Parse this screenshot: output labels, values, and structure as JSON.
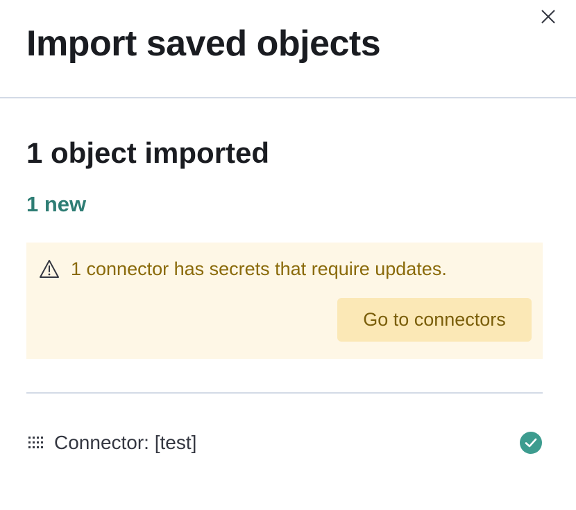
{
  "flyout": {
    "title": "Import saved objects",
    "close_label": "Close"
  },
  "summary": {
    "title": "1 object imported",
    "new_count": "1 new"
  },
  "callout": {
    "message": "1 connector has secrets that require updates.",
    "button_label": "Go to connectors",
    "icon": "warning-icon"
  },
  "items": [
    {
      "type_icon": "connector-grid-icon",
      "title": "Connector: [test]",
      "status_icon": "success-check-icon"
    }
  ],
  "colors": {
    "accent_success": "#2e7d74",
    "success_icon": "#3d9c8f",
    "warning_bg": "#fef7e6",
    "warning_text": "#8a6a0a",
    "warning_button_bg": "#fbe8b6",
    "border": "#d3dae6"
  }
}
